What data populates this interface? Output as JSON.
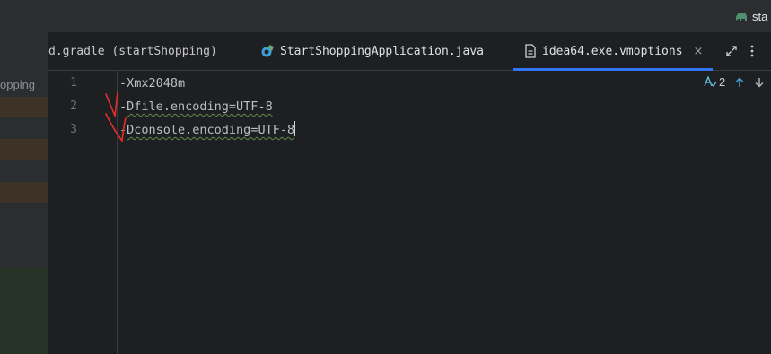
{
  "window": {
    "project_label": "sta",
    "project_icon": "elephant-icon"
  },
  "project_panel": {
    "visible_label": "opping"
  },
  "tabs": [
    {
      "label": "d.gradle (startShopping)",
      "icon": "none",
      "active": false
    },
    {
      "label": "StartShoppingApplication.java",
      "icon": "spring-class-icon",
      "active": false
    },
    {
      "label": "idea64.exe.vmoptions",
      "icon": "file-icon",
      "active": true,
      "close_glyph": "×"
    }
  ],
  "editor": {
    "lines": [
      {
        "number": "1",
        "text": "-Xmx2048m"
      },
      {
        "number": "2",
        "prefix": "-",
        "text": "Dfile.encoding=UTF-8"
      },
      {
        "number": "3",
        "prefix": "-",
        "text": "Dconsole.encoding=UTF-8"
      }
    ],
    "inspection": {
      "count": "2"
    }
  },
  "colors": {
    "background": "#1e1f22",
    "panel": "#2b2d30",
    "accent": "#3574f0",
    "annotation": "#e0302a"
  }
}
